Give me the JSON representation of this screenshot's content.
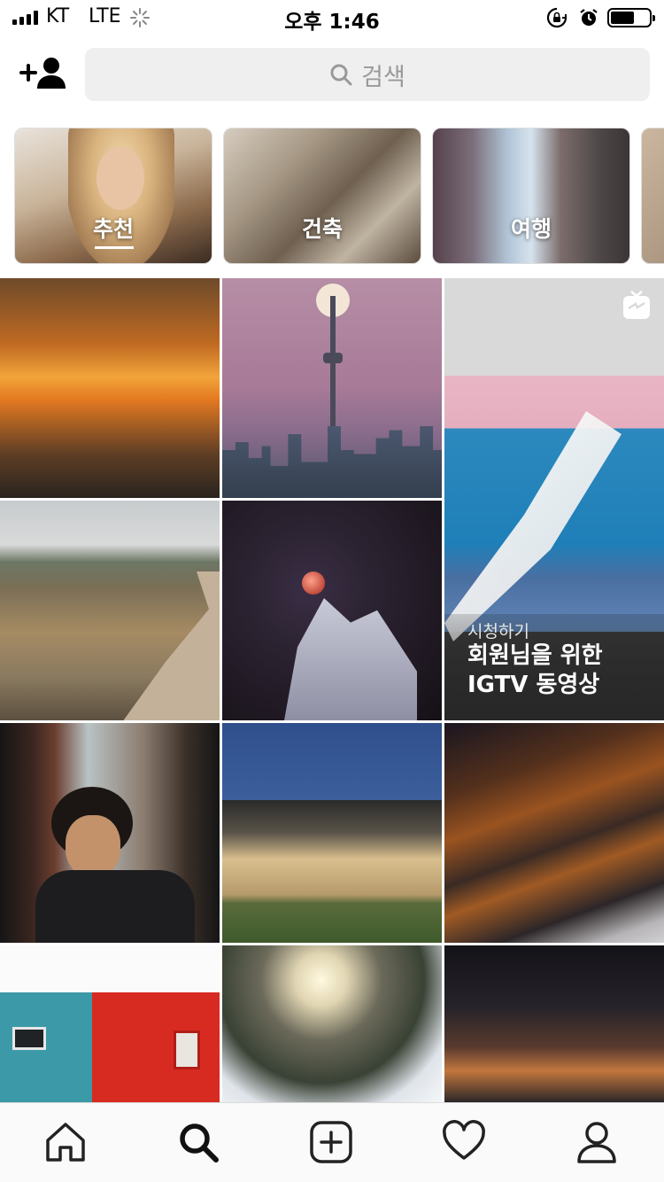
{
  "status_bar": {
    "carrier": "KT",
    "network": "LTE",
    "time": "오후 1:46",
    "icons": [
      "signal-bars-icon",
      "loading-spinner-icon",
      "rotation-lock-icon",
      "alarm-icon",
      "battery-icon"
    ],
    "battery_level": 0.55
  },
  "header": {
    "add_user_icon": "add-user-icon",
    "search_placeholder": "검색"
  },
  "categories": [
    {
      "label": "추천",
      "selected": true
    },
    {
      "label": "건축",
      "selected": false
    },
    {
      "label": "여행",
      "selected": false
    }
  ],
  "igtv_tile": {
    "watch_label": "시청하기",
    "title_line1": "회원님을 위한",
    "title_line2": "IGTV 동영상"
  },
  "tab_bar": {
    "items": [
      "home-icon",
      "search-icon",
      "add-post-icon",
      "heart-icon",
      "profile-icon"
    ],
    "active": "search-icon"
  }
}
